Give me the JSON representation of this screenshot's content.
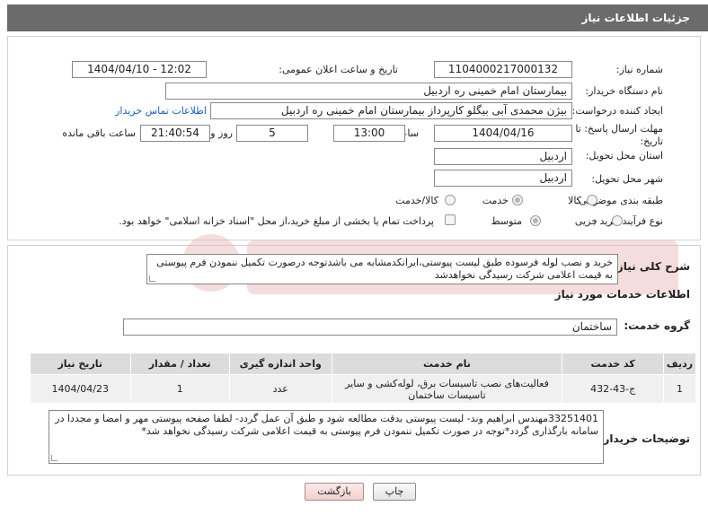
{
  "header": {
    "title": "جزئیات اطلاعات نیاز"
  },
  "form": {
    "need_number_label": "شماره نیاز:",
    "need_number": "1104000217000132",
    "announce_label": "تاریخ و ساعت اعلان عمومی:",
    "announce_value": "1404/04/10 - 12:02",
    "buyer_org_label": "نام دستگاه خریدار:",
    "buyer_org": "بیمارستان امام خمینی  ره  اردبیل",
    "creator_label": "ایجاد کننده درخواست:",
    "creator": "بیژن محمدی آبی بیگلو کارپرداز بیمارستان امام خمینی  ره  اردبیل",
    "contact_link": "اطلاعات تماس خریدار",
    "deadline_label_1": "مهلت ارسال پاسخ: تا",
    "deadline_label_2": "تاریخ:",
    "deadline_date": "1404/04/16",
    "time_label": "ساعت",
    "deadline_time": "13:00",
    "days_value": "5",
    "days_label": "روز و",
    "remaining_time": "21:40:54",
    "remaining_label": "ساعت باقی مانده",
    "province_label": "استان محل تحویل:",
    "province": "اردبیل",
    "city_label": "شهر محل تحویل:",
    "city": "اردبیل",
    "category_label": "طبقه بندی موضوعی:",
    "category_options": [
      "کالا",
      "خدمت",
      "کالا/خدمت"
    ],
    "category_selected": "خدمت",
    "process_label": "نوع فرآیند خرید :",
    "process_options": [
      "جزیی",
      "متوسط"
    ],
    "process_selected": "جزیی",
    "payment_note": "پرداخت تمام یا بخشی از مبلغ خرید،از محل \"اسناد خزانه اسلامی\" خواهد بود."
  },
  "description": {
    "label": "شرح کلی نیاز:",
    "text": "خرید و نصب لوله فرسوده طبق لیست پیوستی،ایرانکدمشابه می باشدتوجه درصورت تکمیل ننمودن فرم پیوستی به قیمت اعلامی شرکت رسیدگی نخواهدشد"
  },
  "services": {
    "section_title": "اطلاعات خدمات مورد نیاز",
    "group_label": "گروه خدمت:",
    "group_value": "ساختمان",
    "columns": [
      "ردیف",
      "کد خدمت",
      "نام خدمت",
      "واحد اندازه گیری",
      "تعداد / مقدار",
      "تاریخ نیاز"
    ],
    "rows": [
      {
        "row": "1",
        "code": "ج-43-432",
        "name": "فعالیت‌های نصب تاسیسات برق، لوله‌کشی و سایر تاسیسات ساختمان",
        "unit": "عدد",
        "qty": "1",
        "date": "1404/04/23"
      }
    ]
  },
  "buyer_notes": {
    "label": "توضیحات خریدار:",
    "text": "33251401مهندس ابراهیم وند- لیست پیوستی بدقت مطالعه شود و طبق آن عمل گردد- لطفا صفحه پیوستی مهر و امضا و مجددا در سامانه بارگذاری گردد*توجه در صورت تکمیل ننمودن فرم پیوستی به قیمت اعلامی شرکت رسیدگی نخواهد شد*"
  },
  "buttons": {
    "print": "چاپ",
    "back": "بازگشت"
  }
}
